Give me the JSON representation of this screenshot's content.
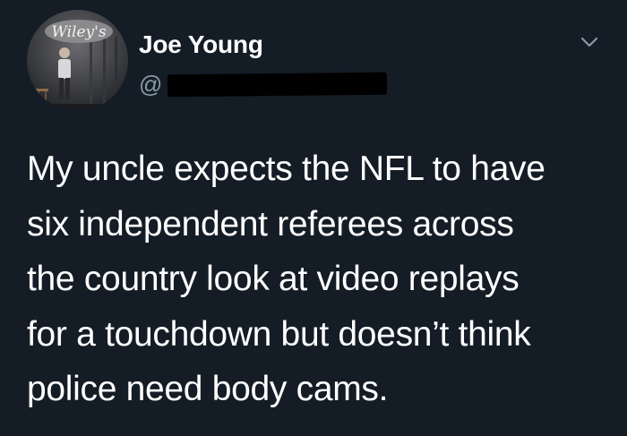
{
  "author": {
    "display_name": "Joe Young",
    "handle_prefix": "@",
    "handle_redacted": true,
    "avatar": {
      "description_icon": "avatar-comedian-on-stage",
      "sign_text": "Wiley's"
    }
  },
  "menu": {
    "icon": "chevron-down-icon"
  },
  "tweet": {
    "lines": [
      "My uncle expects the NFL to have",
      "six independent referees across",
      "the country look at video replays",
      "for a touchdown but doesn’t think",
      "police need body cams."
    ]
  },
  "colors": {
    "background": "#141d26",
    "text_primary": "#ffffff",
    "text_secondary": "#8899a6"
  }
}
